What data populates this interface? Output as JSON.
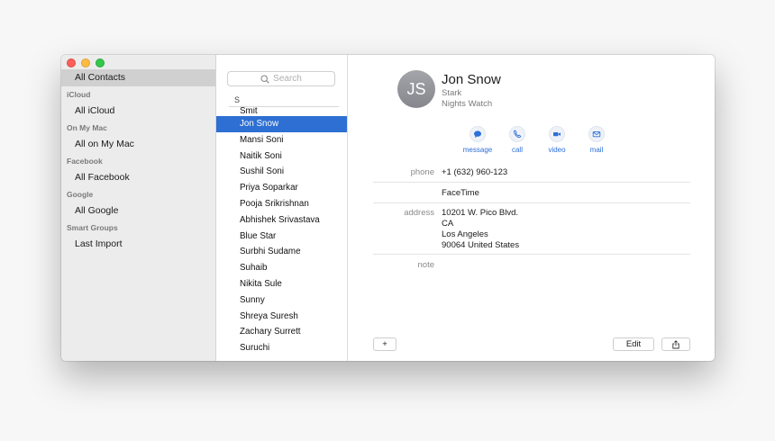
{
  "sidebar": {
    "all_contacts": "All Contacts",
    "sections": [
      {
        "title": "iCloud",
        "item": "All iCloud"
      },
      {
        "title": "On My Mac",
        "item": "All on My Mac"
      },
      {
        "title": "Facebook",
        "item": "All Facebook"
      },
      {
        "title": "Google",
        "item": "All Google"
      },
      {
        "title": "Smart Groups",
        "item": "Last Import"
      }
    ]
  },
  "search": {
    "placeholder": "Search"
  },
  "list": {
    "section_letter": "S",
    "contacts": [
      "Smit",
      "Jon Snow",
      "Mansi Soni",
      "Naitik Soni",
      "Sushil Soni",
      "Priya Soparkar",
      "Pooja Srikrishnan",
      "Abhishek Srivastava",
      "Blue Star",
      "Surbhi Sudame",
      "Suhaib",
      "Nikita Sule",
      "Sunny",
      "Shreya Suresh",
      "Zachary Surrett",
      "Suruchi"
    ],
    "selected": "Jon Snow"
  },
  "contact": {
    "initials": "JS",
    "name": "Jon Snow",
    "company": "Stark",
    "department": "Nights Watch",
    "actions": [
      "message",
      "call",
      "video",
      "mail"
    ],
    "phone_label": "phone",
    "phone": "+1 (632) 960-123",
    "facetime": "FaceTime",
    "address_label": "address",
    "address_lines": [
      "10201 W. Pico Blvd.",
      "CA",
      "Los Angeles",
      "90064 United States"
    ],
    "note_label": "note"
  },
  "buttons": {
    "add": "+",
    "edit": "Edit"
  },
  "colors": {
    "selection": "#2d6fd2",
    "action_text": "#2c6fd8"
  }
}
